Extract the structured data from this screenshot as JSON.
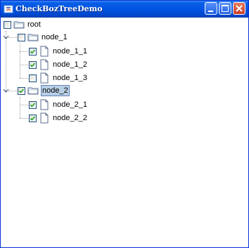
{
  "window": {
    "title": "CheckBozTreeDemo",
    "controls": {
      "minimize": "minimize-icon",
      "maximize": "maximize-icon",
      "close": "close-icon"
    }
  },
  "tree": {
    "root": {
      "label": "root",
      "checked": false
    },
    "node_1": {
      "label": "node_1",
      "checked": false,
      "expanded": true,
      "children": [
        {
          "label": "node_1_1",
          "checked": true
        },
        {
          "label": "node_1_2",
          "checked": true
        },
        {
          "label": "node_1_3",
          "checked": false
        }
      ]
    },
    "node_2": {
      "label": "node_2",
      "checked": true,
      "expanded": true,
      "selected": true,
      "children": [
        {
          "label": "node_2_1",
          "checked": true
        },
        {
          "label": "node_2_2",
          "checked": true
        }
      ]
    }
  },
  "colors": {
    "title_bar": "#0054e3",
    "selection": "#b8cfe5",
    "checkbox_border": "#1c5180",
    "check_mark": "#21a121"
  }
}
